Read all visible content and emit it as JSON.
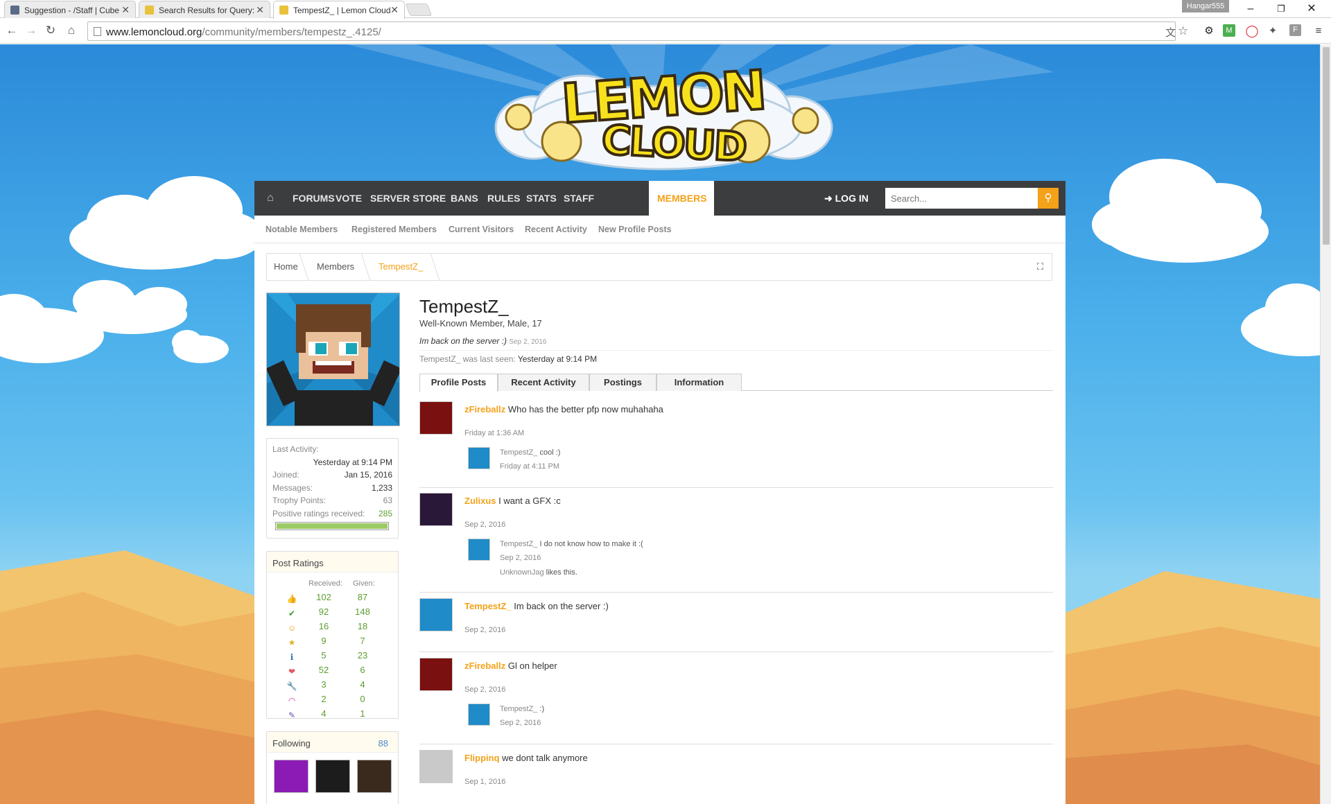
{
  "browser": {
    "tabs": [
      {
        "title": "Suggestion - /Staff | Cube",
        "active": false
      },
      {
        "title": "Search Results for Query:",
        "active": false
      },
      {
        "title": "TempestZ_ | Lemon Cloud",
        "active": true
      }
    ],
    "profile_name": "Hangar555",
    "url_host": "www.lemoncloud.org",
    "url_path": "/community/members/tempestz_.4125/"
  },
  "site": {
    "logo_line1": "LEMON",
    "logo_line2": "CLOUD",
    "nav": {
      "items": [
        "FORUMS",
        "VOTE",
        "SERVER STORE",
        "BANS",
        "RULES",
        "STATS",
        "STAFF",
        "MEMBERS"
      ],
      "active": "MEMBERS",
      "login": "LOG IN",
      "search_placeholder": "Search..."
    },
    "subnav": [
      "Notable Members",
      "Registered Members",
      "Current Visitors",
      "Recent Activity",
      "New Profile Posts"
    ],
    "breadcrumb": [
      "Home",
      "Members",
      "TempestZ_"
    ]
  },
  "profile": {
    "username": "TempestZ_",
    "title_line": "Well-Known Member, Male, 17",
    "status": "Im back on the server :)",
    "status_date": "Sep 2, 2016",
    "last_seen_label": "TempestZ_ was last seen:",
    "last_seen_value": "Yesterday at 9:14 PM",
    "stats": {
      "last_activity_label": "Last Activity:",
      "last_activity_value": "Yesterday at 9:14 PM",
      "joined_label": "Joined:",
      "joined_value": "Jan 15, 2016",
      "messages_label": "Messages:",
      "messages_value": "1,233",
      "trophy_label": "Trophy Points:",
      "trophy_value": "63",
      "positive_label": "Positive ratings received:",
      "positive_value": "285",
      "positive_bar_fraction": 1.0
    },
    "post_ratings": {
      "heading": "Post Ratings",
      "received_label": "Received:",
      "given_label": "Given:",
      "rows": [
        {
          "icon": "like-icon",
          "glyph": "👍",
          "color": "#d98b2b",
          "received": "102",
          "given": "87"
        },
        {
          "icon": "agree-icon",
          "glyph": "✔",
          "color": "#3c9b2f",
          "received": "92",
          "given": "148"
        },
        {
          "icon": "funny-icon",
          "glyph": "☺",
          "color": "#e8a21c",
          "received": "16",
          "given": "18"
        },
        {
          "icon": "winner-icon",
          "glyph": "★",
          "color": "#e0b020",
          "received": "9",
          "given": "7"
        },
        {
          "icon": "informative-icon",
          "glyph": "ℹ",
          "color": "#2f6fc0",
          "received": "5",
          "given": "23"
        },
        {
          "icon": "love-icon",
          "glyph": "❤",
          "color": "#e4575e",
          "received": "52",
          "given": "6"
        },
        {
          "icon": "useful-icon",
          "glyph": "🔧",
          "color": "#a07050",
          "received": "3",
          "given": "4"
        },
        {
          "icon": "rainbow-icon",
          "glyph": "◠",
          "color": "#d43fa0",
          "received": "2",
          "given": "0"
        },
        {
          "icon": "creative-icon",
          "glyph": "✎",
          "color": "#6a55b8",
          "received": "4",
          "given": "1"
        }
      ]
    },
    "following": {
      "heading": "Following",
      "count": "88"
    },
    "tabs": [
      "Profile Posts",
      "Recent Activity",
      "Postings",
      "Information"
    ],
    "active_tab": "Profile Posts",
    "posts": [
      {
        "author": "zFireballz",
        "text": "Who has the better pfp now muhahaha",
        "date": "Friday at 1:36 AM",
        "reply": {
          "author": "TempestZ_",
          "text": "cool :)",
          "date": "Friday at 4:11 PM"
        }
      },
      {
        "author": "Zulixus",
        "text": "I want a GFX :c",
        "date": "Sep 2, 2016",
        "reply": {
          "author": "TempestZ_",
          "text": "I do not know how to make it :(",
          "date": "Sep 2, 2016",
          "liker": "UnknownJag",
          "likes_text": "likes this."
        }
      },
      {
        "author": "TempestZ_",
        "text": "Im back on the server :)",
        "date": "Sep 2, 2016"
      },
      {
        "author": "zFireballz",
        "text": "Gl on helper",
        "date": "Sep 2, 2016",
        "reply": {
          "author": "TempestZ_",
          "text": ":)",
          "date": "Sep 2, 2016"
        }
      },
      {
        "author": "Flippinq",
        "text": "we dont talk anymore",
        "date": "Sep 1, 2016"
      }
    ]
  },
  "colors": {
    "accent": "#f4a21a",
    "nav_bg": "#3c3d3f",
    "positive": "#5c9e2e"
  }
}
